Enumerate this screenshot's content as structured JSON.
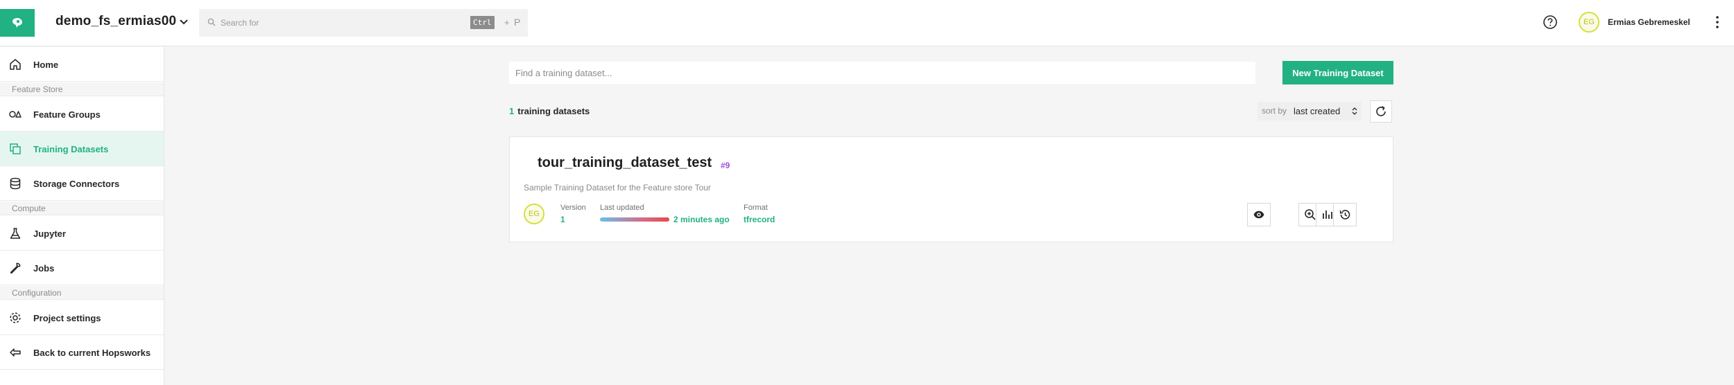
{
  "header": {
    "project_name": "demo_fs_ermias00",
    "search_placeholder": "Search for",
    "shortcut_key": "Ctrl",
    "shortcut_plus": "+",
    "shortcut_letter": "P",
    "user_initials": "EG",
    "user_name": "Ermias Gebremeskel",
    "icons": [
      "hopsworks-logo-icon",
      "chevron-down-icon",
      "search-icon",
      "help-icon",
      "more-vertical-icon"
    ]
  },
  "sidebar": {
    "home": "Home",
    "section_feature_store": "Feature Store",
    "feature_groups": "Feature Groups",
    "training_datasets": "Training Datasets",
    "storage_connectors": "Storage Connectors",
    "section_compute": "Compute",
    "jupyter": "Jupyter",
    "jobs": "Jobs",
    "section_configuration": "Configuration",
    "project_settings": "Project settings",
    "back": "Back to current Hopsworks",
    "active_item": "Training Datasets"
  },
  "main": {
    "search_placeholder": "Find a training dataset...",
    "new_button": "New Training Dataset",
    "count": "1",
    "count_label": "training datasets",
    "sort_label": "sort by",
    "sort_value": "last created"
  },
  "dataset": {
    "name": "tour_training_dataset_test",
    "id_tag": "#9",
    "description": "Sample Training Dataset for the Feature store Tour",
    "owner_initials": "EG",
    "version_label": "Version",
    "version": "1",
    "updated_label": "Last updated",
    "updated": "2 minutes ago",
    "format_label": "Format",
    "format": "tfrecord",
    "actions": [
      "eye-icon",
      "zoom-in-icon",
      "bar-chart-icon",
      "history-icon"
    ]
  },
  "colors": {
    "accent": "#21b182",
    "tag": "#9b4fe0",
    "avatar_ring": "#d6df3f"
  }
}
